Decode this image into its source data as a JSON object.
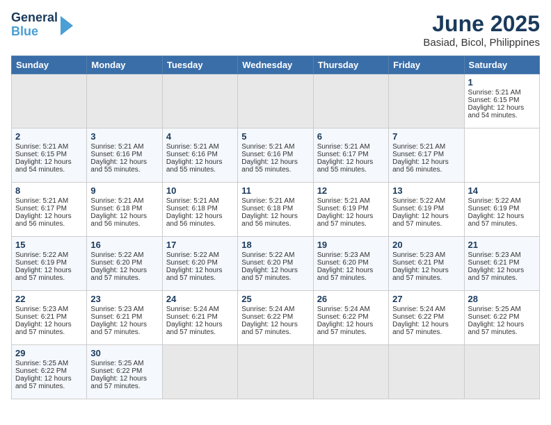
{
  "header": {
    "logo_line1": "General",
    "logo_line2": "Blue",
    "title": "June 2025",
    "subtitle": "Basiad, Bicol, Philippines"
  },
  "calendar": {
    "columns": [
      "Sunday",
      "Monday",
      "Tuesday",
      "Wednesday",
      "Thursday",
      "Friday",
      "Saturday"
    ],
    "rows": [
      [
        {
          "day": "",
          "empty": true
        },
        {
          "day": "",
          "empty": true
        },
        {
          "day": "",
          "empty": true
        },
        {
          "day": "",
          "empty": true
        },
        {
          "day": "",
          "empty": true
        },
        {
          "day": "",
          "empty": true
        },
        {
          "day": "1",
          "sunrise": "5:21 AM",
          "sunset": "6:15 PM",
          "daylight": "12 hours and 54 minutes."
        }
      ],
      [
        {
          "day": "2",
          "sunrise": "5:21 AM",
          "sunset": "6:15 PM",
          "daylight": "12 hours and 54 minutes."
        },
        {
          "day": "3",
          "sunrise": "5:21 AM",
          "sunset": "6:16 PM",
          "daylight": "12 hours and 55 minutes."
        },
        {
          "day": "4",
          "sunrise": "5:21 AM",
          "sunset": "6:16 PM",
          "daylight": "12 hours and 55 minutes."
        },
        {
          "day": "5",
          "sunrise": "5:21 AM",
          "sunset": "6:16 PM",
          "daylight": "12 hours and 55 minutes."
        },
        {
          "day": "6",
          "sunrise": "5:21 AM",
          "sunset": "6:17 PM",
          "daylight": "12 hours and 55 minutes."
        },
        {
          "day": "7",
          "sunrise": "5:21 AM",
          "sunset": "6:17 PM",
          "daylight": "12 hours and 56 minutes."
        }
      ],
      [
        {
          "day": "8",
          "sunrise": "5:21 AM",
          "sunset": "6:17 PM",
          "daylight": "12 hours and 56 minutes."
        },
        {
          "day": "9",
          "sunrise": "5:21 AM",
          "sunset": "6:18 PM",
          "daylight": "12 hours and 56 minutes."
        },
        {
          "day": "10",
          "sunrise": "5:21 AM",
          "sunset": "6:18 PM",
          "daylight": "12 hours and 56 minutes."
        },
        {
          "day": "11",
          "sunrise": "5:21 AM",
          "sunset": "6:18 PM",
          "daylight": "12 hours and 56 minutes."
        },
        {
          "day": "12",
          "sunrise": "5:21 AM",
          "sunset": "6:19 PM",
          "daylight": "12 hours and 57 minutes."
        },
        {
          "day": "13",
          "sunrise": "5:22 AM",
          "sunset": "6:19 PM",
          "daylight": "12 hours and 57 minutes."
        },
        {
          "day": "14",
          "sunrise": "5:22 AM",
          "sunset": "6:19 PM",
          "daylight": "12 hours and 57 minutes."
        }
      ],
      [
        {
          "day": "15",
          "sunrise": "5:22 AM",
          "sunset": "6:19 PM",
          "daylight": "12 hours and 57 minutes."
        },
        {
          "day": "16",
          "sunrise": "5:22 AM",
          "sunset": "6:20 PM",
          "daylight": "12 hours and 57 minutes."
        },
        {
          "day": "17",
          "sunrise": "5:22 AM",
          "sunset": "6:20 PM",
          "daylight": "12 hours and 57 minutes."
        },
        {
          "day": "18",
          "sunrise": "5:22 AM",
          "sunset": "6:20 PM",
          "daylight": "12 hours and 57 minutes."
        },
        {
          "day": "19",
          "sunrise": "5:23 AM",
          "sunset": "6:20 PM",
          "daylight": "12 hours and 57 minutes."
        },
        {
          "day": "20",
          "sunrise": "5:23 AM",
          "sunset": "6:21 PM",
          "daylight": "12 hours and 57 minutes."
        },
        {
          "day": "21",
          "sunrise": "5:23 AM",
          "sunset": "6:21 PM",
          "daylight": "12 hours and 57 minutes."
        }
      ],
      [
        {
          "day": "22",
          "sunrise": "5:23 AM",
          "sunset": "6:21 PM",
          "daylight": "12 hours and 57 minutes."
        },
        {
          "day": "23",
          "sunrise": "5:23 AM",
          "sunset": "6:21 PM",
          "daylight": "12 hours and 57 minutes."
        },
        {
          "day": "24",
          "sunrise": "5:24 AM",
          "sunset": "6:21 PM",
          "daylight": "12 hours and 57 minutes."
        },
        {
          "day": "25",
          "sunrise": "5:24 AM",
          "sunset": "6:22 PM",
          "daylight": "12 hours and 57 minutes."
        },
        {
          "day": "26",
          "sunrise": "5:24 AM",
          "sunset": "6:22 PM",
          "daylight": "12 hours and 57 minutes."
        },
        {
          "day": "27",
          "sunrise": "5:24 AM",
          "sunset": "6:22 PM",
          "daylight": "12 hours and 57 minutes."
        },
        {
          "day": "28",
          "sunrise": "5:25 AM",
          "sunset": "6:22 PM",
          "daylight": "12 hours and 57 minutes."
        }
      ],
      [
        {
          "day": "29",
          "sunrise": "5:25 AM",
          "sunset": "6:22 PM",
          "daylight": "12 hours and 57 minutes."
        },
        {
          "day": "30",
          "sunrise": "5:25 AM",
          "sunset": "6:22 PM",
          "daylight": "12 hours and 57 minutes."
        },
        {
          "day": "",
          "empty": true
        },
        {
          "day": "",
          "empty": true
        },
        {
          "day": "",
          "empty": true
        },
        {
          "day": "",
          "empty": true
        },
        {
          "day": "",
          "empty": true
        }
      ]
    ]
  }
}
